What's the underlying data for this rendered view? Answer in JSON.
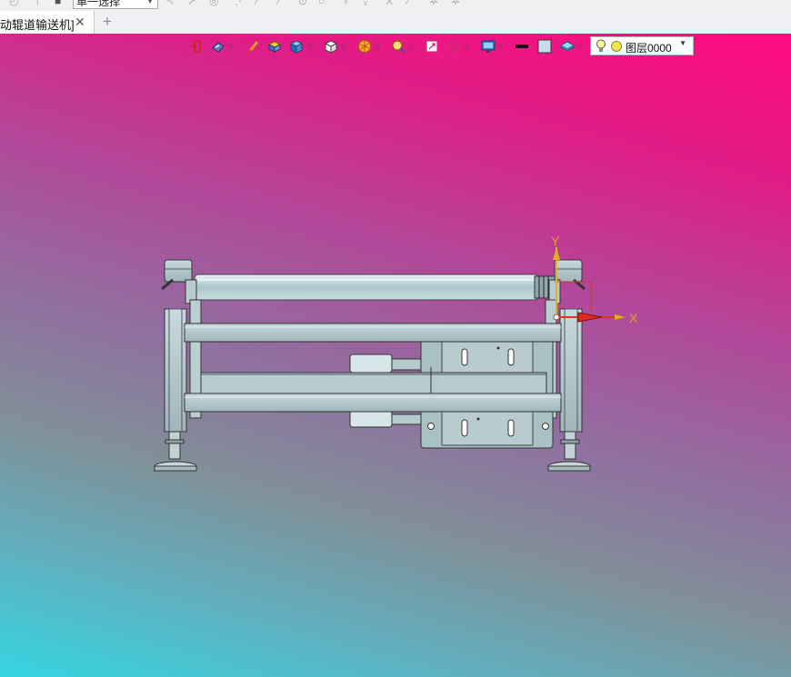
{
  "top_toolbar": {
    "selection_filter": "单一选择"
  },
  "tabs": [
    {
      "label": "动辊道输送机]"
    }
  ],
  "view_toolbar": {
    "icons": [
      "view-exit-icon",
      "view-orientation-icon",
      "sketch-pen-icon",
      "shaded-box-icon",
      "cube-blue-icon",
      "cube-white-icon",
      "render-sphere-icon",
      "zoom-icon",
      "zoom-area-icon",
      "section-view-icon",
      "display-settings-icon",
      "black-line-icon",
      "color-swatch-icon",
      "layer-stack-icon"
    ],
    "layer": {
      "name": "图层0000",
      "bulb": "light-bulb-icon",
      "state": "layer-on-icon"
    }
  },
  "viewport": {
    "gradient_top": "#ff0a80",
    "gradient_bottom": "#35d5e0"
  },
  "triad": {
    "x_label": "X",
    "y_label": "Y",
    "x_color": "#e53020",
    "y_color": "#e0b020"
  }
}
